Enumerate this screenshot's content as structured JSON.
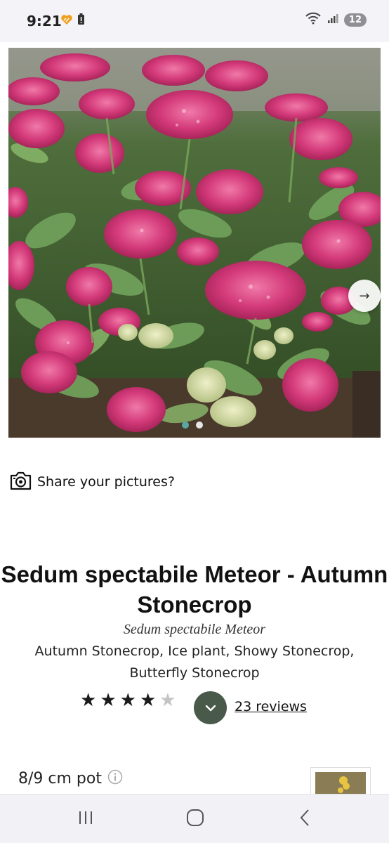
{
  "status_bar": {
    "time": "9:21",
    "notification_badge": "12",
    "icons": [
      "heart-like-icon",
      "battery-alert-icon",
      "wifi-icon",
      "signal-icon"
    ]
  },
  "gallery": {
    "image_description_name": "sedum-flower-photo",
    "current_slide": 1,
    "total_slides": 2,
    "next_arrow": "→"
  },
  "share": {
    "label": "Share your pictures?",
    "icon": "camera-icon"
  },
  "product": {
    "title": "Sedum spectabile Meteor - Autumn Stonecrop",
    "latin_name": "Sedum spectabile Meteor",
    "common_names": "Autumn Stonecrop, Ice plant, Showy Stonecrop, Butterfly Stonecrop",
    "rating": 4,
    "rating_max": 5,
    "reviews_link": "23 reviews"
  },
  "pot": {
    "label": "8/9 cm pot",
    "info_icon": "info-icon"
  },
  "colors": {
    "accent_green": "#4a5a4a",
    "dot_active": "#5aa6a0",
    "star_on": "#1b1b1b",
    "star_off": "#c4c4c4"
  },
  "nav_bar": {
    "buttons": [
      "recents-icon",
      "home-icon",
      "back-icon"
    ]
  }
}
